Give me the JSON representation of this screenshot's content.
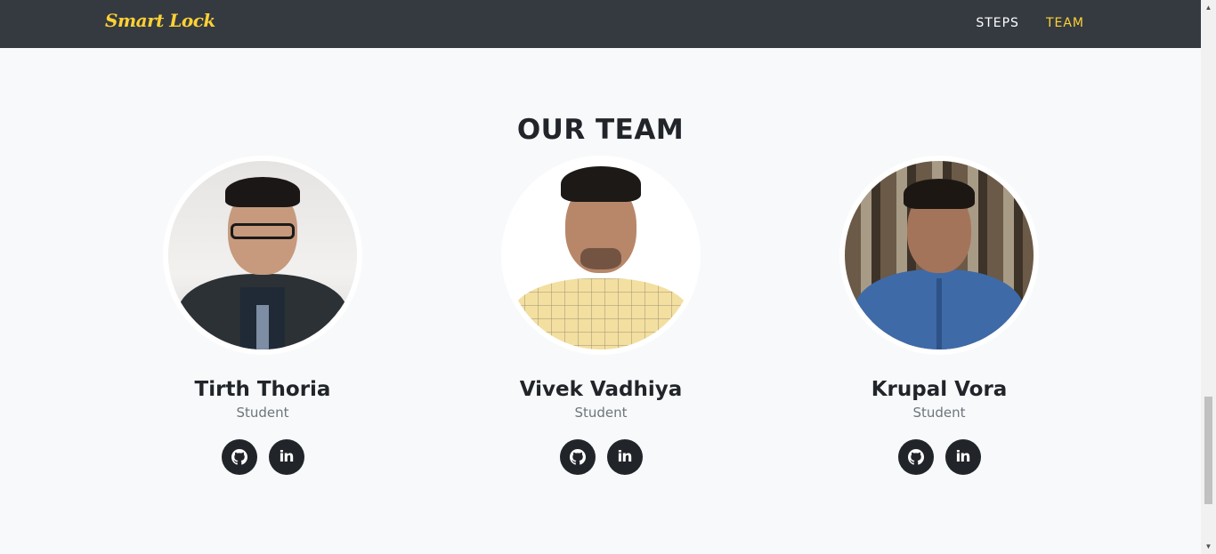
{
  "navbar": {
    "brand": "Smart Lock",
    "links": [
      {
        "label": "STEPS",
        "active": false
      },
      {
        "label": "TEAM",
        "active": true
      }
    ]
  },
  "team": {
    "title": "OUR TEAM",
    "members": [
      {
        "name": "Tirth Thoria",
        "role": "Student",
        "social": [
          "github-icon",
          "linkedin-icon"
        ]
      },
      {
        "name": "Vivek Vadhiya",
        "role": "Student",
        "social": [
          "github-icon",
          "linkedin-icon"
        ]
      },
      {
        "name": "Krupal Vora",
        "role": "Student",
        "social": [
          "github-icon",
          "linkedin-icon"
        ]
      }
    ],
    "linkedin_glyph": "in"
  },
  "colors": {
    "navbar_bg": "#343a40",
    "accent": "#fed136",
    "page_bg": "#f8f9fa",
    "text_dark": "#212529",
    "text_muted": "#6c757d"
  }
}
